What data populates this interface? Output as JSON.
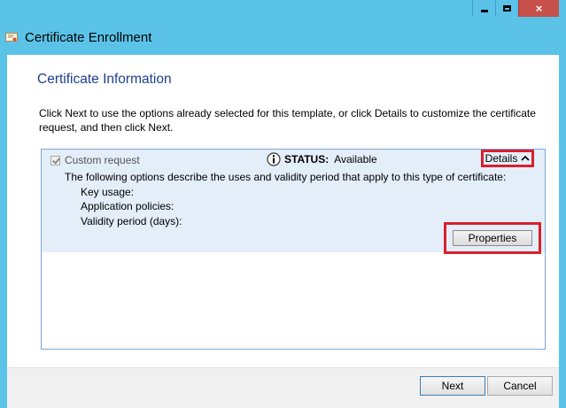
{
  "window": {
    "title": "Certificate Enrollment",
    "close_glyph": "×"
  },
  "page": {
    "title": "Certificate Information",
    "intro": "Click Next to use the options already selected for this template, or click Details to customize the certificate request, and then click Next."
  },
  "request": {
    "checkbox_label": "Custom request",
    "checked": true,
    "status_label": "STATUS:",
    "status_value": "Available",
    "details_label": "Details",
    "description": "The following options describe the uses and validity period that apply to this type of certificate:",
    "fields": [
      "Key usage:",
      "Application policies:",
      "Validity period (days):"
    ],
    "properties_label": "Properties"
  },
  "footer": {
    "next_label": "Next",
    "cancel_label": "Cancel"
  },
  "colors": {
    "title_blue": "#1e3e8c",
    "highlight_red": "#d9202d",
    "chrome_blue": "#5bc3e8"
  }
}
